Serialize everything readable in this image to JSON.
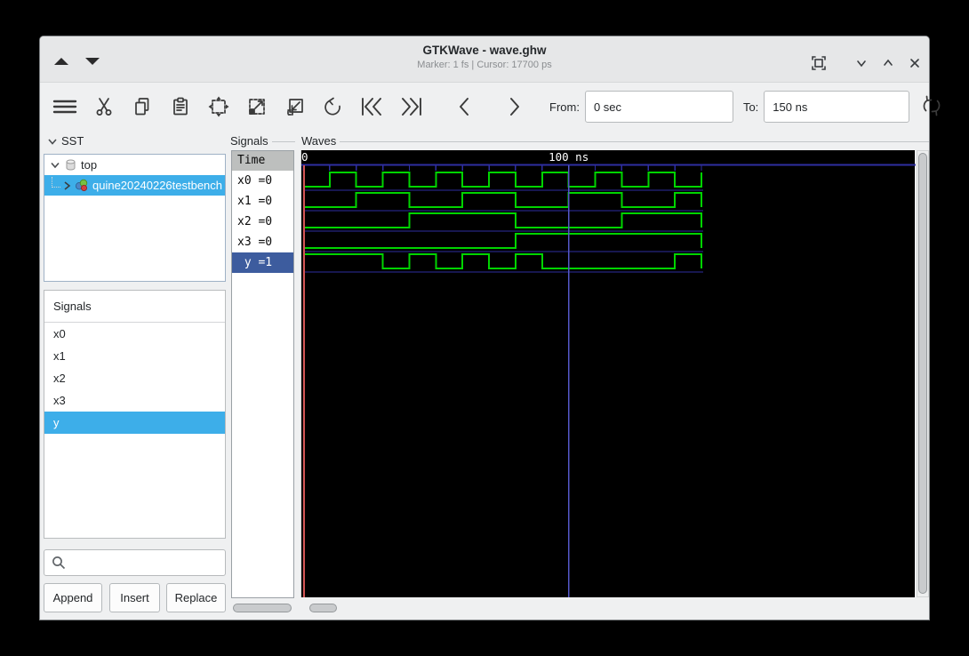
{
  "window": {
    "title": "GTKWave - wave.ghw",
    "status": "Marker: 1 fs  |  Cursor: 17700 ps",
    "titlebar_icons": [
      "scroll-up",
      "scroll-down",
      "fullscreen",
      "minimize",
      "maximize",
      "close"
    ]
  },
  "toolbar": {
    "icon_names": [
      "menu",
      "cut",
      "copy",
      "paste",
      "zoom-fit",
      "zoom-in",
      "zoom-out",
      "undo",
      "jump-to-start",
      "jump-to-end",
      "step-left",
      "step-right",
      "reload"
    ],
    "from_label": "From:",
    "from_value": "0 sec",
    "to_label": "To:",
    "to_value": "150 ns"
  },
  "sst": {
    "label": "SST",
    "tree": [
      {
        "label": "top",
        "icon": "database-cylinder",
        "expanded": true,
        "selected": false
      },
      {
        "label": "quine20240226testbench",
        "icon": "module-colored-circles",
        "expanded": false,
        "selected": true
      }
    ]
  },
  "signal_list": {
    "frame_label": "Signals",
    "items": [
      {
        "label": "x0",
        "selected": false
      },
      {
        "label": "x1",
        "selected": false
      },
      {
        "label": "x2",
        "selected": false
      },
      {
        "label": "x3",
        "selected": false
      },
      {
        "label": "y",
        "selected": true
      }
    ]
  },
  "search": {
    "value": "",
    "icon": "magnifier"
  },
  "actions": {
    "append": "Append",
    "insert": "Insert",
    "replace": "Replace"
  },
  "names_panel": {
    "frame_label": "Signals",
    "header": "Time",
    "rows": [
      {
        "text": "x0 =0",
        "selected": false
      },
      {
        "text": "x1 =0",
        "selected": false
      },
      {
        "text": "x2 =0",
        "selected": false
      },
      {
        "text": "x3 =0",
        "selected": false
      },
      {
        "text": " y =1",
        "selected": true
      }
    ]
  },
  "waves": {
    "frame_label": "Waves"
  },
  "chart_data": {
    "type": "line",
    "title": "GTKWave digital waveforms",
    "x_unit": "ns",
    "x_range": [
      0,
      150
    ],
    "ticks_every_ns": 10,
    "tick_labels": [
      {
        "t": 0,
        "label": "0"
      },
      {
        "t": 100,
        "label": "100 ns"
      }
    ],
    "marker_time": "1 fs",
    "cursor_time": "17700 ps",
    "marker_line_ns": 0,
    "cursor_line_ns": 100,
    "signals": [
      {
        "name": "x0",
        "value_at_marker": 0,
        "high_intervals": [
          [
            10,
            20
          ],
          [
            30,
            40
          ],
          [
            50,
            60
          ],
          [
            70,
            80
          ],
          [
            90,
            100
          ],
          [
            110,
            120
          ],
          [
            130,
            140
          ]
        ]
      },
      {
        "name": "x1",
        "value_at_marker": 0,
        "high_intervals": [
          [
            20,
            40
          ],
          [
            60,
            80
          ],
          [
            100,
            120
          ],
          [
            140,
            150
          ]
        ]
      },
      {
        "name": "x2",
        "value_at_marker": 0,
        "high_intervals": [
          [
            40,
            80
          ],
          [
            120,
            150
          ]
        ]
      },
      {
        "name": "x3",
        "value_at_marker": 0,
        "high_intervals": [
          [
            80,
            150
          ]
        ]
      },
      {
        "name": "y",
        "value_at_marker": 1,
        "high_intervals": [
          [
            0,
            30
          ],
          [
            40,
            50
          ],
          [
            60,
            70
          ],
          [
            80,
            90
          ],
          [
            140,
            150
          ]
        ]
      }
    ],
    "colors": {
      "wave": "#00d400",
      "grid": "#2e2ea0",
      "cursor_line": "#5457c8",
      "marker_line": "#d35555",
      "background": "#000000",
      "timeline_text": "#ffffff"
    }
  }
}
